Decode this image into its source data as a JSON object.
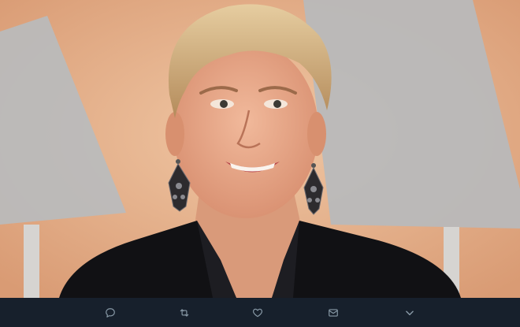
{
  "media": {
    "alt": "",
    "type": "photo"
  },
  "actions": [
    {
      "id": "reply",
      "icon": "reply-icon",
      "count": ""
    },
    {
      "id": "retweet",
      "icon": "retweet-icon",
      "count": ""
    },
    {
      "id": "like",
      "icon": "heart-icon",
      "count": ""
    },
    {
      "id": "dm",
      "icon": "envelope-icon",
      "count": ""
    },
    {
      "id": "more",
      "icon": "chevron-down-icon",
      "count": ""
    }
  ],
  "colors": {
    "bar_bg": "#17202c",
    "icon": "#8899a6",
    "backdrop_peach": "#e8b48e",
    "backdrop_gray": "#b9bcbf",
    "jacket": "#111114",
    "hair": "#d9b98a",
    "skin": "#e7ab8d"
  }
}
